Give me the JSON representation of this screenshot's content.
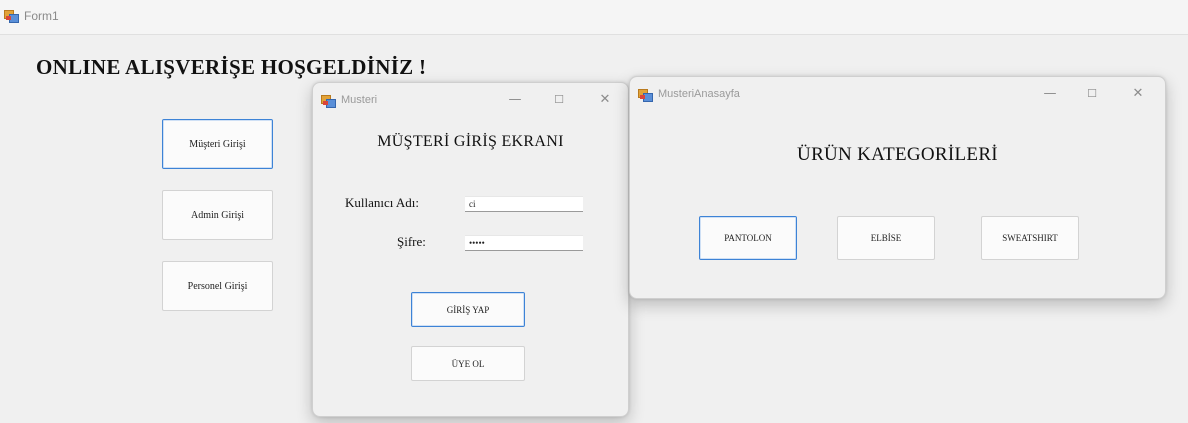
{
  "form1": {
    "title": "Form1",
    "heading": "ONLINE ALIŞVERİŞE HOŞGELDİNİZ !",
    "buttons": {
      "musteri": "Müşteri Girişi",
      "admin": "Admin Girişi",
      "personel": "Personel Girişi"
    }
  },
  "musteri_window": {
    "title": "Musteri",
    "heading": "MÜŞTERİ GİRİŞ EKRANI",
    "username_label": "Kullanıcı Adı:",
    "username_value": "ci",
    "password_label": "Şifre:",
    "password_value": "•••••",
    "login_button": "GİRİŞ YAP",
    "register_button": "ÜYE OL",
    "controls": {
      "minimize": "—",
      "maximize": "☐",
      "close": "✕"
    }
  },
  "anasayfa_window": {
    "title": "MusteriAnasayfa",
    "heading": "ÜRÜN KATEGORİLERİ",
    "categories": [
      "PANTOLON",
      "ELBİSE",
      "SWEATSHIRT"
    ],
    "controls": {
      "minimize": "—",
      "maximize": "☐",
      "close": "✕"
    }
  },
  "icons": {
    "app": "winforms-app-icon",
    "minimize": "minimize-icon",
    "maximize": "maximize-icon",
    "close": "close-icon"
  }
}
